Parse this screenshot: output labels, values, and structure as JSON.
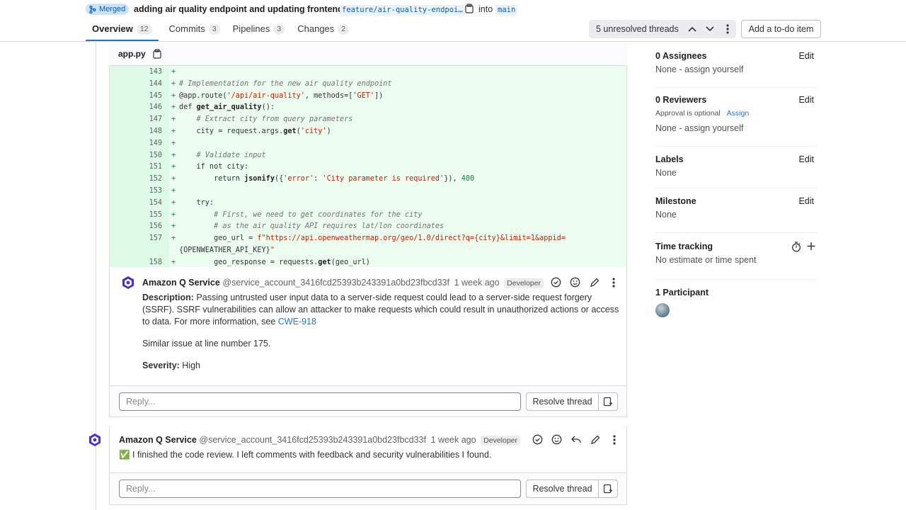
{
  "header": {
    "status": "Merged",
    "title": "adding air quality endpoint and updating frontend.",
    "source_branch": "feature/air-quality-endpoi…",
    "into": "into",
    "target_branch": "main"
  },
  "tabs": [
    {
      "label": "Overview",
      "count": "12"
    },
    {
      "label": "Commits",
      "count": "3"
    },
    {
      "label": "Pipelines",
      "count": "3"
    },
    {
      "label": "Changes",
      "count": "2"
    }
  ],
  "threads": {
    "label": "5 unresolved threads"
  },
  "todo_label": "Add a to-do item",
  "file": {
    "name": "app.py"
  },
  "code_lines": [
    {
      "n": "143",
      "code": ""
    },
    {
      "n": "144",
      "code": "# Implementation for the new air quality endpoint"
    },
    {
      "n": "145",
      "code": "@app.route('/api/air-quality', methods=['GET'])"
    },
    {
      "n": "146",
      "code": "def get_air_quality():"
    },
    {
      "n": "147",
      "code": "    # Extract city from query parameters"
    },
    {
      "n": "148",
      "code": "    city = request.args.get('city')"
    },
    {
      "n": "149",
      "code": ""
    },
    {
      "n": "150",
      "code": "    # Validate input"
    },
    {
      "n": "151",
      "code": "    if not city:"
    },
    {
      "n": "152",
      "code": "        return jsonify({'error': 'City parameter is required'}), 400"
    },
    {
      "n": "153",
      "code": ""
    },
    {
      "n": "154",
      "code": "    try:"
    },
    {
      "n": "155",
      "code": "        # First, we need to get coordinates for the city"
    },
    {
      "n": "156",
      "code": "        # as the air quality API requires lat/lon coordinates"
    },
    {
      "n": "157",
      "code": "        geo_url = f\"https://api.openweathermap.org/geo/1.0/direct?q={city}&limit=1&appid="
    },
    {
      "n": "",
      "code": "{OPENWEATHER_API_KEY}\""
    },
    {
      "n": "158",
      "code": "        geo_response = requests.get(geo_url)"
    }
  ],
  "note1": {
    "author": "Amazon Q Service",
    "handle": "@service_account_3416fcd25393b243391a0bd23fbcd33f",
    "time": "1 week ago",
    "role": "Developer",
    "desc_label": "Description:",
    "desc_line1": " Passing untrusted user input data to a server-side request could lead to a server-side request forgery",
    "desc_line2": "(SSRF). SSRF vulnerabilities can allow an attacker to make requests which could result in unauthorized actions or access",
    "desc_line3": "to data. For more information, see ",
    "desc_link": "CWE-918",
    "similar": "Similar issue at line number 175.",
    "severity_label": "Severity:",
    "severity_value": " High"
  },
  "reply": {
    "placeholder": "Reply...",
    "resolve_label": "Resolve thread"
  },
  "note2": {
    "author": "Amazon Q Service",
    "handle": "@service_account_3416fcd25393b243391a0bd23fbcd33f",
    "time": "1 week ago",
    "role": "Developer",
    "check": "✅",
    "text": " I finished the code review. I left comments with feedback and security vulnerabilities I found."
  },
  "sidebar": {
    "edit": "Edit",
    "assignees_title": "0 Assignees",
    "assignees_value": "None - assign yourself",
    "reviewers_title": "0 Reviewers",
    "approval": "Approval is optional",
    "assign": "Assign",
    "reviewers_value": "None - assign yourself",
    "labels_title": "Labels",
    "labels_value": "None",
    "milestone_title": "Milestone",
    "milestone_value": "None",
    "time_title": "Time tracking",
    "time_value": "No estimate or time spent",
    "participants_title": "1 Participant"
  },
  "colors": {
    "accent": "#1f75cb",
    "added_bg": "#ecfdf0",
    "merged_badge": "#cbe2f9"
  }
}
